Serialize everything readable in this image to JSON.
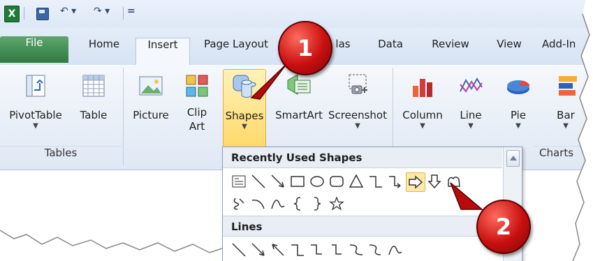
{
  "qat": {
    "app_icon": "X",
    "undo": "↶ ▾",
    "redo": "↷ ▾",
    "customize": "="
  },
  "tabs": [
    {
      "label": "File"
    },
    {
      "label": "Home"
    },
    {
      "label": "Insert"
    },
    {
      "label": "Page Layout"
    },
    {
      "label": "las"
    },
    {
      "label": "Data"
    },
    {
      "label": "Review"
    },
    {
      "label": "View"
    },
    {
      "label": "Add-In"
    }
  ],
  "groups": {
    "tables": {
      "label": "Tables",
      "pivot": "PivotTable",
      "table": "Table"
    },
    "illustrations": {
      "picture": "Picture",
      "clip_art_1": "Clip",
      "clip_art_2": "Art",
      "shapes": "Shapes",
      "smartart": "SmartArt",
      "screenshot": "Screenshot"
    },
    "charts": {
      "label": "Charts",
      "column": "Column",
      "line": "Line",
      "pie": "Pie",
      "bar": "Bar"
    }
  },
  "dropdown": {
    "recent_header": "Recently Used Shapes",
    "lines_header": "Lines"
  },
  "callouts": {
    "first": "1",
    "second": "2"
  },
  "colors": {
    "file_tab": "#2f7a41",
    "selected": "#ffd96a",
    "callout": "#c80f0f"
  }
}
